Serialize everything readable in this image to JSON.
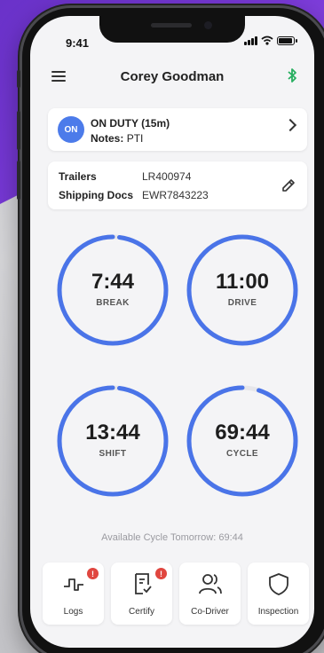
{
  "status_bar": {
    "time": "9:41"
  },
  "header": {
    "title": "Corey Goodman",
    "bluetooth_icon": "bluetooth-icon",
    "menu_icon": "menu-icon"
  },
  "duty": {
    "badge": "ON",
    "status": "ON DUTY (15m)",
    "notes_label": "Notes:",
    "notes_value": "PTI",
    "badge_color": "#4c7bea"
  },
  "documents": {
    "trailers_label": "Trailers",
    "trailers_value": "LR400974",
    "shipping_label": "Shipping Docs",
    "shipping_value": "EWR7843223"
  },
  "timers": [
    {
      "value": "7:44",
      "label": "BREAK",
      "remaining_fraction": 0.98
    },
    {
      "value": "11:00",
      "label": "DRIVE",
      "remaining_fraction": 1.0
    },
    {
      "value": "13:44",
      "label": "SHIFT",
      "remaining_fraction": 0.98
    },
    {
      "value": "69:44",
      "label": "CYCLE",
      "remaining_fraction": 0.95
    }
  ],
  "ring_color": "#4a74e8",
  "ring_track_color": "#e6e6ea",
  "cycle_note": "Available Cycle Tomorrow: 69:44",
  "tabs": [
    {
      "label": "Logs",
      "icon": "logs-icon",
      "alert": "!"
    },
    {
      "label": "Certify",
      "icon": "certify-icon",
      "alert": "!"
    },
    {
      "label": "Co-Driver",
      "icon": "co-driver-icon"
    },
    {
      "label": "Inspection",
      "icon": "shield-icon"
    }
  ],
  "alert_color": "#e0463f"
}
